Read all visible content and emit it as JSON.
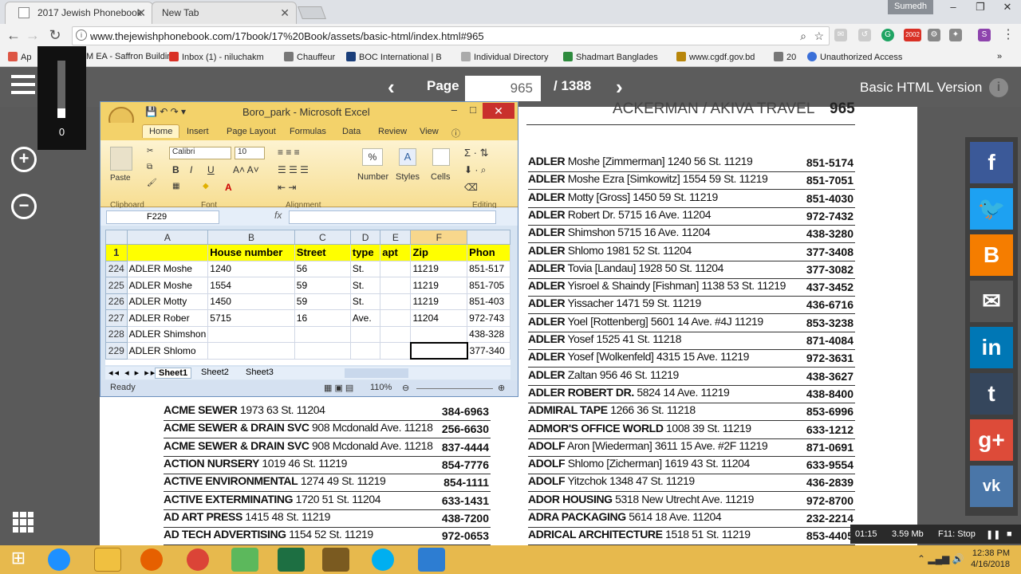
{
  "browser": {
    "tabs": [
      {
        "label": "2017 Jewish Phonebook"
      },
      {
        "label": "New Tab"
      }
    ],
    "profile": "Sumedh",
    "url": "www.thejewishphonebook.com/17book/17%20Book/assets/basic-html/index.html#965",
    "bookmarks": [
      "Ap",
      "M EA - Saffron Buildin",
      "Inbox (1) - niluchakm",
      "Chauffeur",
      "BOC International | B",
      "Individual Directory",
      "Shadmart Banglades",
      "www.cgdf.gov.bd",
      "20",
      "Unauthorized Access"
    ],
    "ext_badge": "2002"
  },
  "viewer": {
    "page_label": "Page",
    "page_value": "965",
    "page_total": "/ 1388",
    "basic_html": "Basic HTML Version",
    "slider_value": "0"
  },
  "phonebook": {
    "header": "ACKERMAN  /  AKIVA TRAVEL",
    "page_number": "965",
    "right_col": [
      {
        "name": "ADLER",
        "addr": "Moshe [Zimmerman] 1240 56 St. 11219",
        "phone": "851-5174"
      },
      {
        "name": "ADLER",
        "addr": "Moshe Ezra [Simkowitz] 1554 59 St. 11219",
        "phone": "851-7051"
      },
      {
        "name": "ADLER",
        "addr": "Motty [Gross] 1450 59 St. 11219",
        "phone": "851-4030"
      },
      {
        "name": "ADLER",
        "addr": "Robert Dr. 5715 16 Ave. 11204",
        "phone": "972-7432"
      },
      {
        "name": "ADLER",
        "addr": "Shimshon 5715 16 Ave. 11204",
        "phone": "438-3280"
      },
      {
        "name": "ADLER",
        "addr": "Shlomo 1981 52 St. 11204",
        "phone": "377-3408"
      },
      {
        "name": "ADLER",
        "addr": "Tovia [Landau] 1928 50 St. 11204",
        "phone": "377-3082"
      },
      {
        "name": "ADLER",
        "addr": "Yisroel & Shaindy [Fishman] 1138 53 St. 11219",
        "phone": "437-3452"
      },
      {
        "name": "ADLER",
        "addr": "Yissacher 1471 59 St. 11219",
        "phone": "436-6716"
      },
      {
        "name": "ADLER",
        "addr": "Yoel [Rottenberg] 5601 14 Ave. #4J 11219",
        "phone": "853-3238"
      },
      {
        "name": "ADLER",
        "addr": "Yosef 1525 41 St. 11218",
        "phone": "871-4084"
      },
      {
        "name": "ADLER",
        "addr": "Yosef [Wolkenfeld] 4315 15 Ave. 11219",
        "phone": "972-3631"
      },
      {
        "name": "ADLER",
        "addr": "Zaltan 956 46 St. 11219",
        "phone": "438-3627"
      },
      {
        "name": "ADLER ROBERT DR.",
        "addr": "5824 14 Ave. 11219",
        "phone": "438-8400"
      },
      {
        "name": "ADMIRAL TAPE",
        "addr": "1266 36 St. 11218",
        "phone": "853-6996"
      },
      {
        "name": "ADMOR'S OFFICE WORLD",
        "addr": "1008 39 St. 11219",
        "phone": "633-1212"
      },
      {
        "name": "ADOLF",
        "addr": "Aron [Wiederman] 3611 15 Ave. #2F 11219",
        "phone": "871-0691"
      },
      {
        "name": "ADOLF",
        "addr": "Shlomo [Zicherman] 1619 43 St. 11204",
        "phone": "633-9554"
      },
      {
        "name": "ADOLF",
        "addr": "Yitzchok 1348 47 St. 11219",
        "phone": "436-2839"
      },
      {
        "name": "ADOR HOUSING",
        "addr": "5318 New Utrecht Ave. 11219",
        "phone": "972-8700"
      },
      {
        "name": "ADRA PACKAGING",
        "addr": "5614 18 Ave. 11204",
        "phone": "232-2214"
      },
      {
        "name": "ADRICAL ARCHITECTURE",
        "addr": "1518 51 St. 11219",
        "phone": "853-4405"
      }
    ],
    "left_col": [
      {
        "name": "ACME SEWER",
        "addr": "1973 63 St. 11204",
        "phone": "384-6963"
      },
      {
        "name": "ACME SEWER & DRAIN SVC",
        "addr": "908 Mcdonald Ave. 11218",
        "phone": "256-6630"
      },
      {
        "name": "ACME SEWER & DRAIN SVC",
        "addr": "908 Mcdonald Ave. 11218",
        "phone": "837-4444"
      },
      {
        "name": "ACTION NURSERY",
        "addr": "1019 46 St. 11219",
        "phone": "854-7776"
      },
      {
        "name": "ACTIVE ENVIRONMENTAL",
        "addr": "1274 49 St. 11219",
        "phone": "854-1111"
      },
      {
        "name": "ACTIVE EXTERMINATING",
        "addr": "1720 51 St. 11204",
        "phone": "633-1431"
      },
      {
        "name": "AD ART PRESS",
        "addr": "1415 48 St. 11219",
        "phone": "438-7200"
      },
      {
        "name": "AD TECH ADVERTISING",
        "addr": "1154 52 St. 11219",
        "phone": "972-0653"
      }
    ]
  },
  "excel": {
    "title": "Boro_park - Microsoft Excel",
    "tabs": [
      "Home",
      "Insert",
      "Page Layout",
      "Formulas",
      "Data",
      "Review",
      "View"
    ],
    "groups": [
      "Clipboard",
      "Font",
      "Alignment",
      "Number",
      "Styles",
      "Cells",
      "Editing"
    ],
    "font_name": "Calibri",
    "font_size": "10",
    "paste": "Paste",
    "number": "Number",
    "styles": "Styles",
    "cells": "Cells",
    "name_box": "F229",
    "fx": "fx",
    "columns": [
      "A",
      "B",
      "C",
      "D",
      "E",
      "F"
    ],
    "header_row": {
      "num": "1",
      "cells": [
        "",
        "House number",
        "Street",
        "type",
        "apt",
        "Zip",
        "Phon"
      ]
    },
    "rows": [
      {
        "num": "224",
        "cells": [
          "ADLER Moshe",
          "1240",
          "56",
          "St.",
          "",
          "11219",
          "851-517"
        ]
      },
      {
        "num": "225",
        "cells": [
          "ADLER Moshe",
          "1554",
          "59",
          "St.",
          "",
          "11219",
          "851-705"
        ]
      },
      {
        "num": "226",
        "cells": [
          "ADLER Motty",
          "1450",
          "59",
          "St.",
          "",
          "11219",
          "851-403"
        ]
      },
      {
        "num": "227",
        "cells": [
          "ADLER Rober",
          "5715",
          "16",
          "Ave.",
          "",
          "11204",
          "972-743"
        ]
      },
      {
        "num": "228",
        "cells": [
          "ADLER Shimshon",
          "",
          "",
          "",
          "",
          "",
          "438-328"
        ]
      },
      {
        "num": "229",
        "cells": [
          "ADLER Shlomo",
          "",
          "",
          "",
          "",
          "",
          "377-340"
        ]
      }
    ],
    "sheets": [
      "Sheet1",
      "Sheet2",
      "Sheet3"
    ],
    "status": "Ready",
    "zoom": "110%"
  },
  "recorder": {
    "time": "01:15",
    "size": "3.59 Mb",
    "stop": "F11: Stop"
  },
  "clock": {
    "time": "12:38 PM",
    "date": "4/16/2018"
  }
}
